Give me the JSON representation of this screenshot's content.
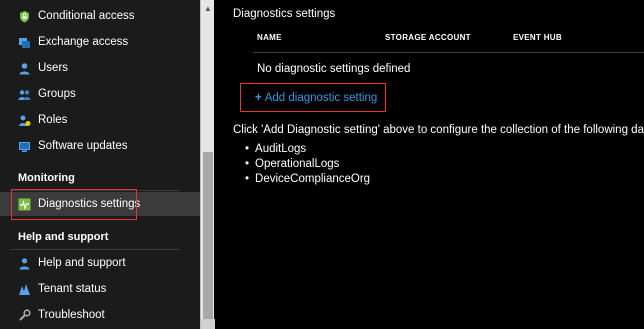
{
  "sidebar": {
    "items_top": [
      {
        "label": "Conditional access",
        "icon": "lock-shield-icon"
      },
      {
        "label": "Exchange access",
        "icon": "exchange-icon"
      },
      {
        "label": "Users",
        "icon": "user-icon"
      },
      {
        "label": "Groups",
        "icon": "groups-icon"
      },
      {
        "label": "Roles",
        "icon": "roles-icon"
      },
      {
        "label": "Software updates",
        "icon": "software-updates-icon"
      }
    ],
    "monitoring_title": "Monitoring",
    "monitoring_items": [
      {
        "label": "Diagnostics settings",
        "icon": "diagnostics-icon",
        "selected": true
      }
    ],
    "help_title": "Help and support",
    "help_items": [
      {
        "label": "Help and support",
        "icon": "person-help-icon"
      },
      {
        "label": "Tenant status",
        "icon": "tenant-status-icon"
      },
      {
        "label": "Troubleshoot",
        "icon": "troubleshoot-icon"
      }
    ]
  },
  "main": {
    "title": "Diagnostics settings",
    "columns": [
      "NAME",
      "STORAGE ACCOUNT",
      "EVENT HUB"
    ],
    "empty_message": "No diagnostic settings defined",
    "add_button_label": "Add diagnostic setting",
    "info_text": "Click 'Add Diagnostic setting' above to configure the collection of the following data:",
    "data_types": [
      "AuditLogs",
      "OperationalLogs",
      "DeviceComplianceOrg"
    ]
  },
  "colors": {
    "accent": "#3a96dd",
    "highlight": "#e63333",
    "icon_blue": "#5aa0e6",
    "icon_green": "#7bc043",
    "icon_yellow": "#f2c811"
  }
}
